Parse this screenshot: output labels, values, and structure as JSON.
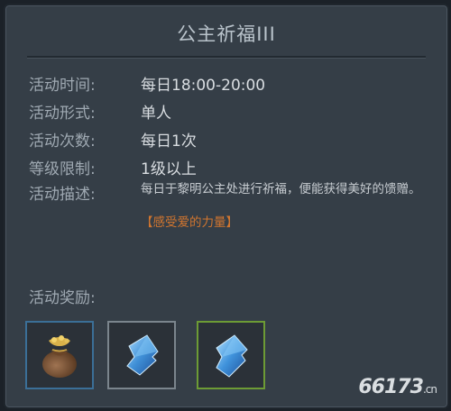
{
  "title": "公主祈福III",
  "rows": [
    {
      "label": "活动时间:",
      "value": "每日18:00-20:00"
    },
    {
      "label": "活动形式:",
      "value": "单人"
    },
    {
      "label": "活动次数:",
      "value": "每日1次"
    },
    {
      "label": "等级限制:",
      "value": "1级以上"
    },
    {
      "label": "活动描述:",
      "value": "每日于黎明公主处进行祈福，便能获得美好的馈赠。"
    }
  ],
  "desc_tag": "【感受爱的力量】",
  "rewards_label": "活动奖励:",
  "rewards": [
    {
      "icon": "money-bag-icon",
      "border_color": "#3b6f97"
    },
    {
      "icon": "blue-crystal-icon",
      "border_color": "#7b858d"
    },
    {
      "icon": "blue-crystal-icon",
      "border_color": "#6d9b35"
    }
  ],
  "watermark": {
    "main": "66173",
    "suffix": ".cn"
  }
}
